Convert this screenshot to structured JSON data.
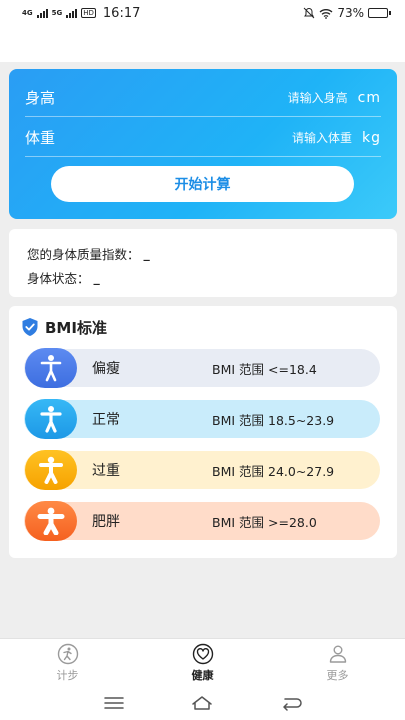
{
  "status_bar": {
    "signal_1": "4G",
    "signal_2": "5G",
    "hd": "HD",
    "time": "16:17",
    "battery_percent": "73%",
    "battery_level": 0.73
  },
  "calculator": {
    "height_label": "身高",
    "height_placeholder": "请输入身高",
    "height_unit": "cm",
    "weight_label": "体重",
    "weight_placeholder": "请输入体重",
    "weight_unit": "kg",
    "start_button": "开始计算",
    "background_color": "#2aa6f5"
  },
  "result": {
    "bmi_label": "您的身体质量指数：",
    "bmi_value": "_",
    "status_label": "身体状态：",
    "status_value": "_"
  },
  "standard": {
    "title": "BMI标准",
    "items": [
      {
        "name": "偏瘦",
        "range": "BMI 范围 <=18.4",
        "color": "#4a7ee8"
      },
      {
        "name": "正常",
        "range": "BMI 范围 18.5~23.9",
        "color": "#29aaf0"
      },
      {
        "name": "过重",
        "range": "BMI 范围 24.0~27.9",
        "color": "#fbb515"
      },
      {
        "name": "肥胖",
        "range": "BMI 范围 >=28.0",
        "color": "#f87332"
      }
    ]
  },
  "bottom_nav": {
    "items": [
      {
        "label": "计步",
        "icon": "step-icon",
        "active": false
      },
      {
        "label": "健康",
        "icon": "heart-icon",
        "active": true
      },
      {
        "label": "更多",
        "icon": "person-icon",
        "active": false
      }
    ]
  }
}
